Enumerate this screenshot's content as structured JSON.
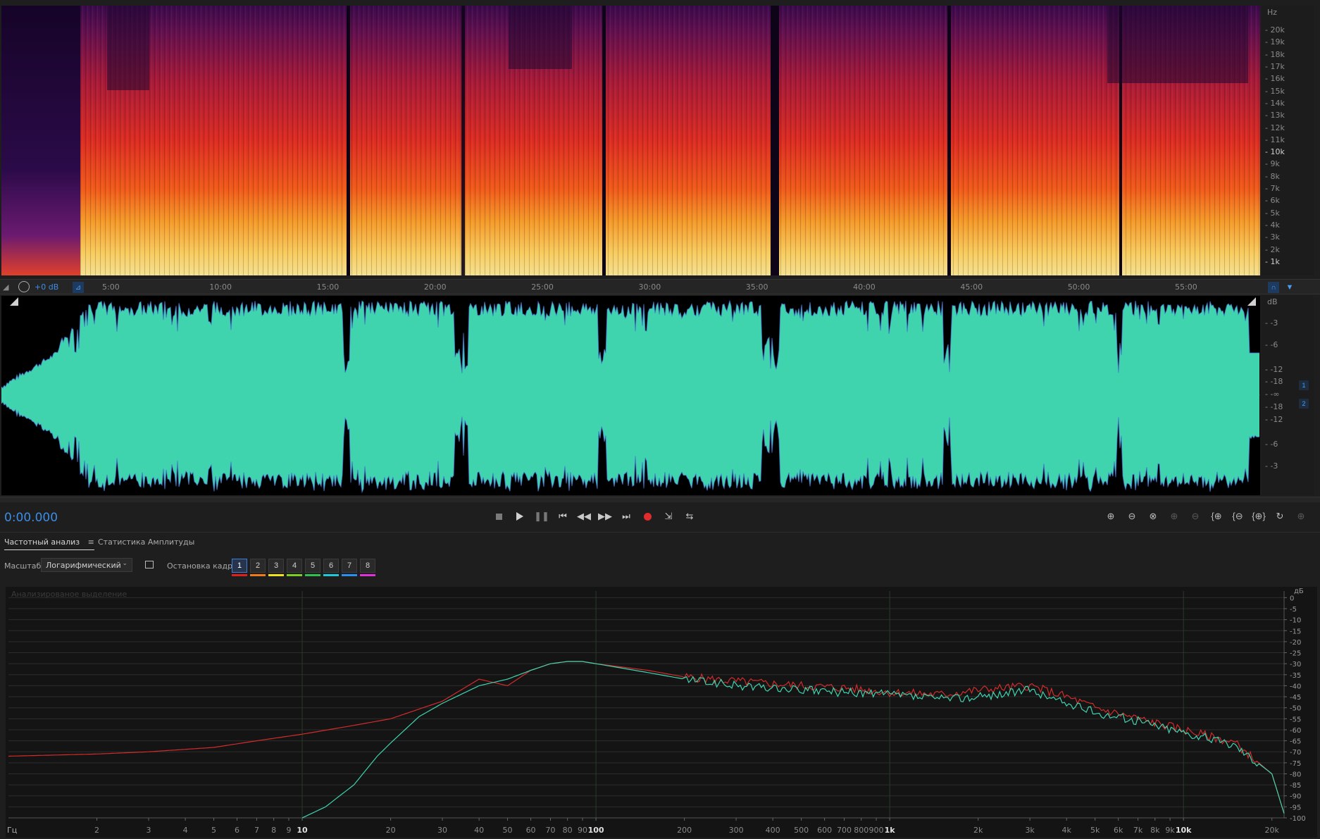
{
  "spectral": {
    "unit": "Hz",
    "freq_ticks": [
      "20k",
      "19k",
      "18k",
      "17k",
      "16k",
      "15k",
      "14k",
      "13k",
      "12k",
      "11k",
      "10k",
      "9k",
      "8k",
      "7k",
      "6k",
      "5k",
      "4k",
      "3k",
      "2k",
      "1k"
    ]
  },
  "timeline": {
    "level": "+0 dB",
    "ticks": [
      "5:00",
      "10:00",
      "15:00",
      "20:00",
      "25:00",
      "30:00",
      "35:00",
      "40:00",
      "45:00",
      "50:00",
      "55:00"
    ]
  },
  "waveform": {
    "unit": "dB",
    "db_ticks": [
      "-3",
      "-6",
      "-12",
      "-18",
      "-∞",
      "-18",
      "-12",
      "-6",
      "-3"
    ],
    "channels": [
      "1",
      "2"
    ],
    "color": "#3fd3ae"
  },
  "transport": {
    "time": "0:00.000",
    "buttons": [
      "stop",
      "play",
      "pause",
      "go-to-start",
      "rewind",
      "fast-forward",
      "go-to-end",
      "record",
      "skip",
      "loop"
    ]
  },
  "analysis_panel": {
    "tab_frequency": "Частотный анализ",
    "tab_amplitude": "Статистика Амплитуды",
    "scale_label": "Масштаб:",
    "scale_value": "Логарифмический",
    "freeze_label": "Остановка кадра:",
    "frames": [
      "1",
      "2",
      "3",
      "4",
      "5",
      "6",
      "7",
      "8"
    ],
    "frame_colors": [
      "#e0201c",
      "#ef7a1c",
      "#f0e020",
      "#7ad020",
      "#30c050",
      "#20c8d8",
      "#2a8ff0",
      "#e030d8"
    ],
    "overlay_text": "Анализированое выделение"
  },
  "chart_data": {
    "type": "line",
    "xscale": "log",
    "xlabel": "Гц",
    "ylabel": "дБ",
    "xlim": [
      1,
      22000
    ],
    "ylim": [
      -100,
      3
    ],
    "x_tick_labels": [
      "2",
      "3",
      "4",
      "5",
      "6",
      "7",
      "8",
      "9",
      "10",
      "20",
      "30",
      "40",
      "50",
      "60",
      "70",
      "80",
      "90",
      "100",
      "200",
      "300",
      "400",
      "500",
      "600",
      "700",
      "800",
      "900",
      "1k",
      "2k",
      "3k",
      "4k",
      "5k",
      "6k",
      "7k",
      "8k",
      "9k",
      "10k",
      "20k"
    ],
    "y_tick_labels": [
      "0",
      "-5",
      "-10",
      "-15",
      "-20",
      "-25",
      "-30",
      "-35",
      "-40",
      "-45",
      "-50",
      "-55",
      "-60",
      "-65",
      "-70",
      "-75",
      "-80",
      "-85",
      "-90",
      "-95",
      "-100"
    ],
    "series": [
      {
        "color": "#d22c2c",
        "x": [
          1,
          2,
          3,
          5,
          7,
          10,
          15,
          20,
          30,
          40,
          50,
          60,
          70,
          80,
          90,
          100,
          150,
          200,
          300,
          500,
          700,
          1000,
          1500,
          2000,
          3000,
          4000,
          5000,
          7000,
          10000,
          15000,
          20000,
          22000
        ],
        "y": [
          -72,
          -71,
          -70,
          -68,
          -65,
          -62,
          -58,
          -55,
          -47,
          -37,
          -40,
          -33,
          -30,
          -29,
          -29,
          -30,
          -33,
          -36,
          -38,
          -40,
          -41,
          -43,
          -44,
          -42,
          -40,
          -45,
          -50,
          -55,
          -60,
          -66,
          -80,
          -98
        ]
      },
      {
        "color": "#3fd3ae",
        "x": [
          10,
          12,
          15,
          18,
          20,
          25,
          30,
          40,
          50,
          60,
          70,
          80,
          90,
          100,
          150,
          200,
          300,
          500,
          700,
          1000,
          1500,
          2000,
          3000,
          4000,
          5000,
          7000,
          10000,
          15000,
          20000,
          22000
        ],
        "y": [
          -100,
          -95,
          -85,
          -72,
          -66,
          -54,
          -48,
          -40,
          -37,
          -33,
          -30,
          -29,
          -29,
          -30,
          -34,
          -37,
          -40,
          -42,
          -43,
          -44,
          -46,
          -45,
          -42,
          -48,
          -52,
          -56,
          -61,
          -67,
          -80,
          -98
        ]
      }
    ]
  }
}
